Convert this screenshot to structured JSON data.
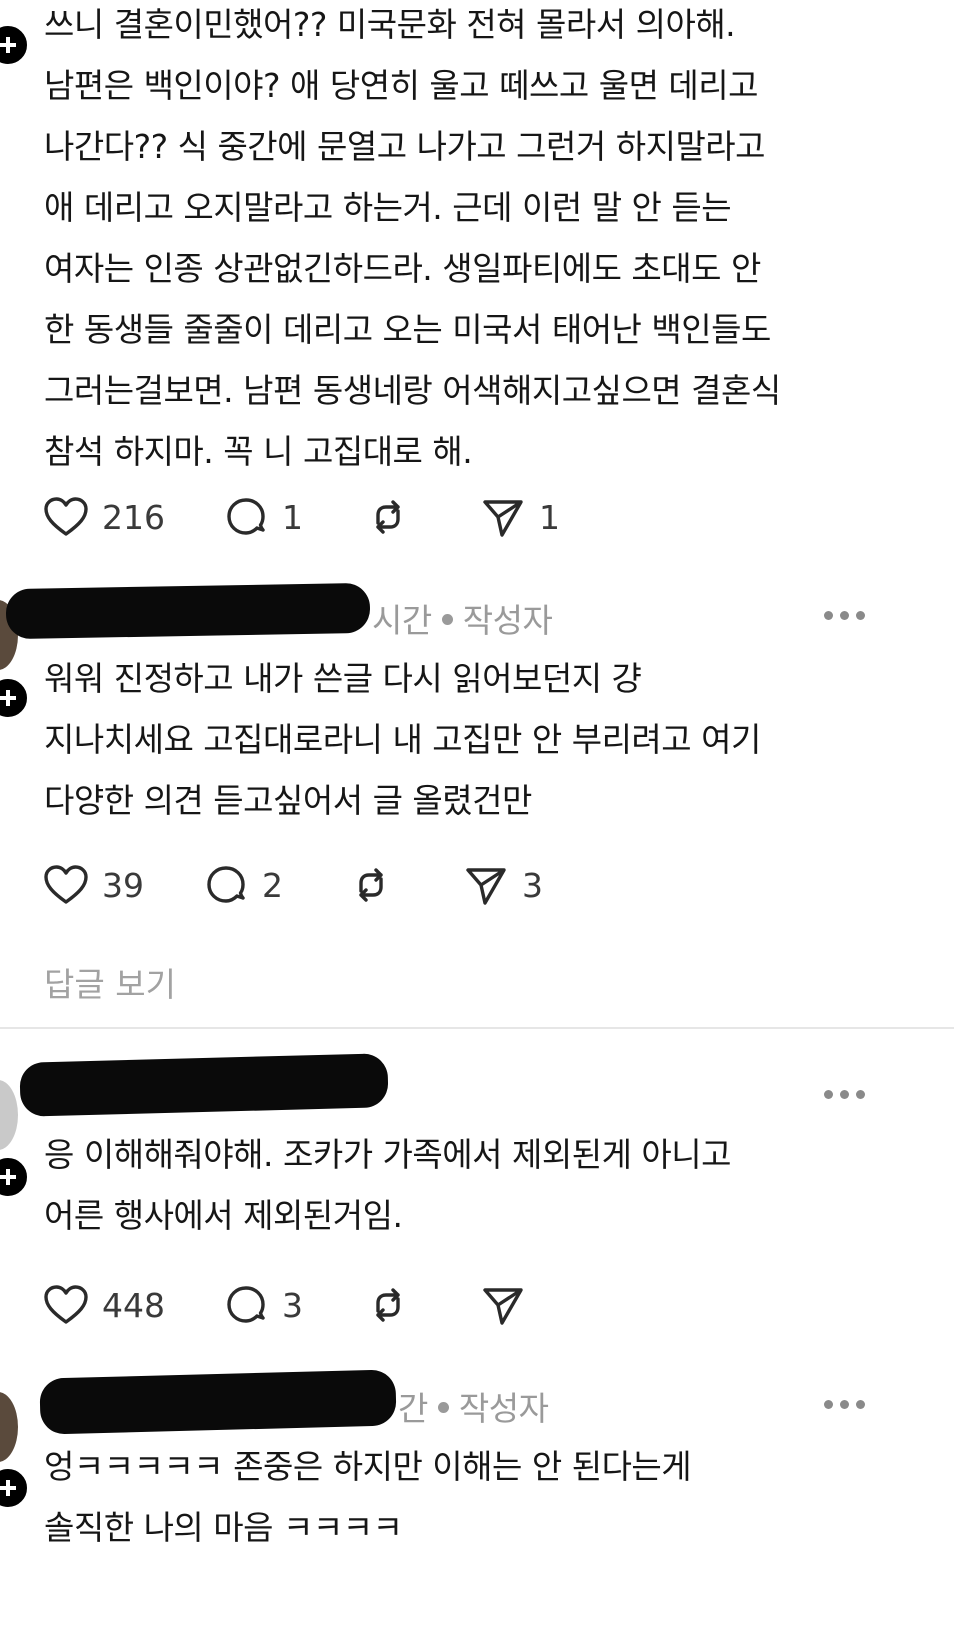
{
  "comments": [
    {
      "text": "쓰니 결혼이민했어?? 미국문화 전혀 몰라서 의아해.\n남편은 백인이야? 애 당연히 울고 떼쓰고 울면 데리고\n나간다?? 식 중간에 문열고 나가고 그런거 하지말라고\n애 데리고 오지말라고 하는거. 근데 이런 말 안 듣는\n여자는 인종 상관없긴하드라. 생일파티에도 초대도 안\n한 동생들 줄줄이 데리고 오는 미국서 태어난 백인들도\n그러는걸보면. 남편 동생네랑 어색해지고싶으면 결혼식\n참석 하지마. 꼭 니 고집대로 해.",
      "likes": "216",
      "replies": "1",
      "shares": "1"
    },
    {
      "meta_time": "시간",
      "meta_author": "작성자",
      "text": "워워 진정하고 내가 쓴글 다시 읽어보던지 걍\n지나치세요 고집대로라니 내 고집만 안 부리려고 여기\n다양한 의견 듣고싶어서 글 올렸건만",
      "likes": "39",
      "replies": "2",
      "shares": "3",
      "view_replies": "답글 보기"
    },
    {
      "text": "응 이해해줘야해. 조카가 가족에서 제외된게 아니고\n어른 행사에서 제외된거임.",
      "likes": "448",
      "replies": "3",
      "shares": ""
    },
    {
      "meta_time": "간",
      "meta_author": "작성자",
      "text": "엉ㅋㅋㅋㅋㅋ 존중은 하지만 이해는 안 된다는게\n솔직한 나의 마음 ㅋㅋㅋㅋ"
    }
  ],
  "icons": {
    "like": "heart-icon",
    "reply": "comment-bubble-icon",
    "repost": "repost-icon",
    "share": "send-icon",
    "follow": "follow-plus-icon",
    "more": "more-options-icon"
  }
}
